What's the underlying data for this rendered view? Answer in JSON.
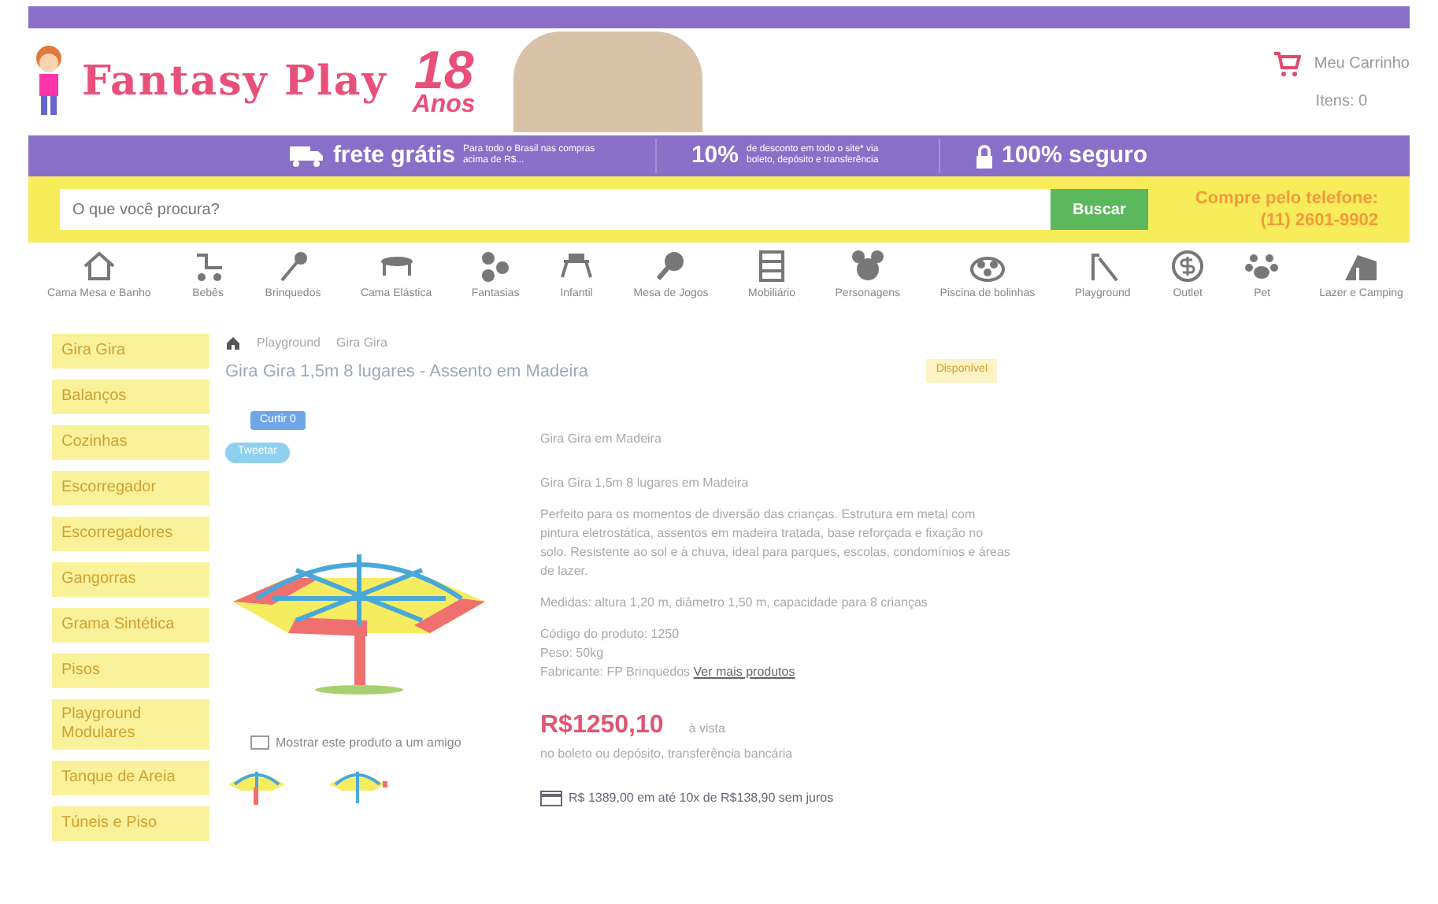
{
  "header": {
    "logo": "Fantasy Play",
    "anniversary": "18",
    "anniversary_label": "Anos",
    "cart_label": "Meu Carrinho",
    "cart_count": "Itens: 0"
  },
  "benefits": [
    {
      "kind": "truck",
      "title": "frete grátis",
      "note": "Para todo o Brasil nas compras acima de R$..."
    },
    {
      "kind": "discount",
      "title": "10%",
      "note": "de desconto em todo o site* via boleto, depósito e transferência"
    },
    {
      "kind": "lock",
      "title": "100% seguro"
    }
  ],
  "search": {
    "placeholder": "O que você procura?",
    "button": "Buscar",
    "phone_label": "Compre pelo telefone:",
    "phone": "(11) 2601-9902"
  },
  "categories": [
    {
      "kind": "house",
      "label": "Cama Mesa e Banho"
    },
    {
      "kind": "stroller",
      "label": "Bebês"
    },
    {
      "kind": "wand",
      "label": "Brinquedos"
    },
    {
      "kind": "trampoline",
      "label": "Cama Elástica"
    },
    {
      "kind": "balls",
      "label": "Fantasias"
    },
    {
      "kind": "table",
      "label": "Infantil"
    },
    {
      "kind": "paddle",
      "label": "Mesa de Jogos"
    },
    {
      "kind": "shelf",
      "label": "Mobiliário"
    },
    {
      "kind": "mouse",
      "label": "Personagens"
    },
    {
      "kind": "pool",
      "label": "Piscina de bolinhas"
    },
    {
      "kind": "slide",
      "label": "Playground"
    },
    {
      "kind": "dollar",
      "label": "Outlet"
    },
    {
      "kind": "paw",
      "label": "Pet"
    },
    {
      "kind": "tent",
      "label": "Lazer e Camping"
    }
  ],
  "sidebar": {
    "items": [
      "Gira Gira",
      "Balanços",
      "Cozinhas",
      "Escorregador",
      "Escorregadores",
      "Gangorras",
      "Grama Sintética",
      "Pisos",
      "Playground Modulares",
      "Tanque de Areia",
      "Túneis e Piso"
    ]
  },
  "breadcrumb": [
    "Playground",
    "Gira Gira"
  ],
  "product": {
    "title": "Gira Gira 1,5m 8 lugares - Assento em Madeira",
    "stock": "Disponível",
    "like": "Curtir 0",
    "tweet": "Tweetar",
    "subtitle": "Gira Gira em Madeira",
    "heading": "Gira Gira 1,5m 8 lugares em Madeira",
    "description": "Perfeito para os momentos de diversão das crianças. Estrutura em metal com pintura eletrostática, assentos em madeira tratada, base reforçada e fixação no solo. Resistente ao sol e à chuva, ideal para parques, escolas, condomínios e áreas de lazer.",
    "measures": "Medidas: altura 1,20 m, diâmetro 1,50 m, capacidade para 8 crianças",
    "code": "Código do produto: 1250",
    "weight": "Peso: 50kg",
    "maker": "Fabricante: FP Brinquedos",
    "maker_link": "Ver mais produtos",
    "price": "R$1250,10",
    "price_note": "à vista",
    "price_detail": "no boleto ou depósito, transferência bancária",
    "installments": "R$ 1389,00 em até 10x de R$138,90 sem juros",
    "share": "Mostrar este produto a um amigo"
  }
}
